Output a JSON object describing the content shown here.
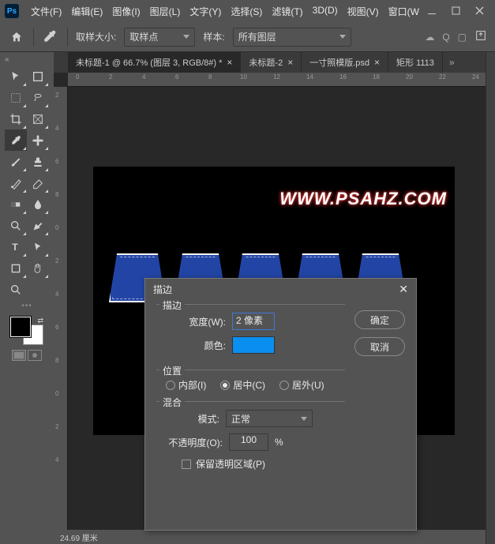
{
  "app_icon": "Ps",
  "menu": {
    "file": "文件(F)",
    "edit": "编辑(E)",
    "image": "图像(I)",
    "layer": "图层(L)",
    "type": "文字(Y)",
    "select": "选择(S)",
    "filter": "滤镜(T)",
    "td": "3D(D)",
    "view": "视图(V)",
    "window": "窗口(W"
  },
  "options": {
    "sample_size_label": "取样大小:",
    "sample_size_value": "取样点",
    "sample_label": "样本:",
    "sample_value": "所有图层"
  },
  "tabs": {
    "t1": "未标题-1 @ 66.7% (图层 3, RGB/8#) *",
    "t2": "未标题-2",
    "t3": "一寸照模版.psd",
    "t4": "矩形 1113"
  },
  "ruler_h": {
    "m0": "0",
    "m2": "2",
    "m4": "4",
    "m6": "6",
    "m8": "8",
    "m10": "10",
    "m12": "12",
    "m14": "14",
    "m16": "16",
    "m18": "18",
    "m20": "20",
    "m22": "22",
    "m24": "24"
  },
  "ruler_v": {
    "m2": "2",
    "m4": "4",
    "m6": "6",
    "m8": "8",
    "m0": "0",
    "m2b": "2",
    "m4b": "4",
    "m6b": "6",
    "m8b": "8",
    "m0b": "0",
    "m2c": "2",
    "m4c": "4"
  },
  "canvas": {
    "watermark": "WWW.PSAHZ.COM"
  },
  "status": {
    "text": "24.69 厘米"
  },
  "dialog": {
    "title": "描边",
    "section_stroke": "描边",
    "width_label": "宽度(W):",
    "width_value": "2 像素",
    "color_label": "颜色:",
    "section_position": "位置",
    "pos_inside": "内部(I)",
    "pos_center": "居中(C)",
    "pos_outside": "居外(U)",
    "section_blend": "混合",
    "mode_label": "模式:",
    "mode_value": "正常",
    "opacity_label": "不透明度(O):",
    "opacity_value": "100",
    "opacity_suffix": "%",
    "preserve": "保留透明区域(P)",
    "ok": "确定",
    "cancel": "取消"
  }
}
